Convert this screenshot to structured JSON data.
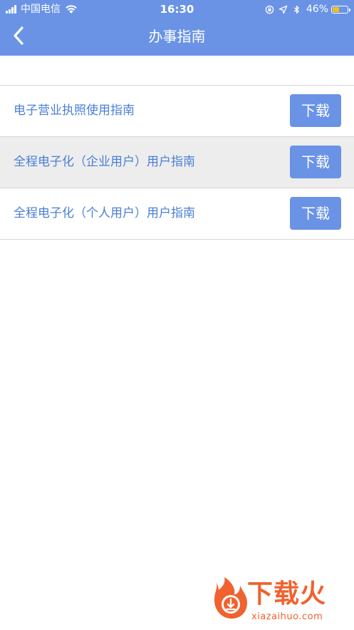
{
  "status_bar": {
    "carrier": "中国电信",
    "time": "16:30",
    "battery_percent_text": "46%",
    "battery_level": 0.46,
    "icons": [
      "signal-icon",
      "wifi-icon",
      "orientation-lock-icon",
      "location-icon",
      "bluetooth-icon",
      "battery-icon"
    ]
  },
  "nav": {
    "title": "办事指南",
    "back_icon": "chevron-left-icon"
  },
  "guides": [
    {
      "title": "电子营业执照使用指南",
      "action": "下载",
      "highlighted": false
    },
    {
      "title": "全程电子化（企业用户）用户指南",
      "action": "下载",
      "highlighted": true
    },
    {
      "title": "全程电子化（个人用户）用户指南",
      "action": "下载",
      "highlighted": false
    }
  ],
  "watermark": {
    "brand": "下载火",
    "domain": "xiazaihuo.com"
  },
  "colors": {
    "header_blue": "#6a93e6",
    "link_blue": "#4a7fd6",
    "row_highlight": "#ededed",
    "divider": "#d6d6d6",
    "battery_yellow": "#f2c01b",
    "watermark_orange": "#f0622f"
  }
}
